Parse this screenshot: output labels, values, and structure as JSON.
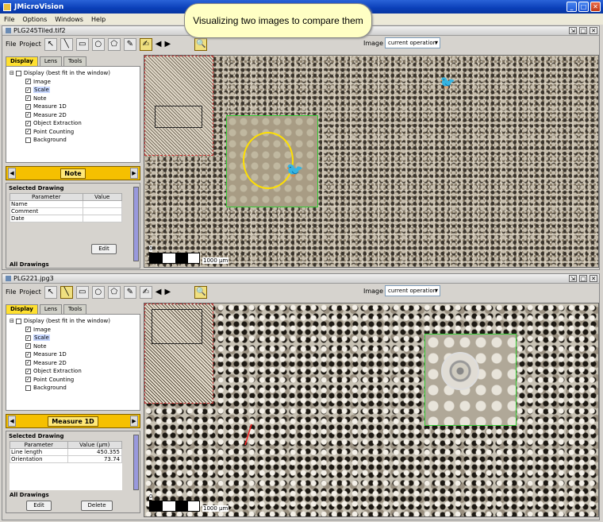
{
  "app": {
    "title": "JMicroVision",
    "menu": [
      "File",
      "Options",
      "Windows",
      "Help"
    ]
  },
  "callout": "Visualizing two images to compare them",
  "windows": [
    {
      "title": "PLG245Tiled.tif2",
      "toolbar": {
        "file": "File",
        "project": "Project",
        "image_label": "Image :",
        "image_value": "current operation"
      },
      "tabs": [
        "Display",
        "Lens",
        "Tools"
      ],
      "tree": {
        "root": "Display (best fit in the window)",
        "items": [
          {
            "label": "Image",
            "checked": true
          },
          {
            "label": "Scale",
            "checked": true
          },
          {
            "label": "Note",
            "checked": true
          },
          {
            "label": "Measure 1D",
            "checked": true
          },
          {
            "label": "Measure 2D",
            "checked": true
          },
          {
            "label": "Object Extraction",
            "checked": true
          },
          {
            "label": "Point Counting",
            "checked": true
          },
          {
            "label": "Background",
            "checked": false
          }
        ]
      },
      "mode": "Note",
      "selected_title": "Selected Drawing",
      "columns": [
        "Parameter",
        "Value"
      ],
      "rows": [
        [
          "Name",
          ""
        ],
        [
          "Comment",
          ""
        ],
        [
          "Date",
          ""
        ]
      ],
      "buttons": {
        "edit": "Edit"
      },
      "all_drawings": "All Drawings",
      "scale": {
        "zero": "0",
        "label": "1000 µm"
      }
    },
    {
      "title": "PLG221.jpg3",
      "toolbar": {
        "file": "File",
        "project": "Project",
        "image_label": "Image :",
        "image_value": "current operation"
      },
      "tabs": [
        "Display",
        "Lens",
        "Tools"
      ],
      "tree": {
        "root": "Display (best fit in the window)",
        "items": [
          {
            "label": "Image",
            "checked": true
          },
          {
            "label": "Scale",
            "checked": true
          },
          {
            "label": "Note",
            "checked": true
          },
          {
            "label": "Measure 1D",
            "checked": true
          },
          {
            "label": "Measure 2D",
            "checked": true
          },
          {
            "label": "Object Extraction",
            "checked": true
          },
          {
            "label": "Point Counting",
            "checked": true
          },
          {
            "label": "Background",
            "checked": false
          }
        ]
      },
      "mode": "Measure 1D",
      "selected_title": "Selected Drawing",
      "columns": [
        "Parameter",
        "Value (µm)"
      ],
      "rows": [
        [
          "Line length",
          "450.355"
        ],
        [
          "Orientation",
          "73.74"
        ]
      ],
      "buttons": {
        "edit": "Edit",
        "delete": "Delete"
      },
      "all_drawings": "All Drawings",
      "scale": {
        "zero": "0",
        "label": "1000 µm"
      }
    }
  ],
  "colors": {
    "title_bar": "#0a3fb8",
    "mode_bar": "#f5c000",
    "zoom_border": "#33cc33",
    "thumb_border": "#cc3333"
  }
}
